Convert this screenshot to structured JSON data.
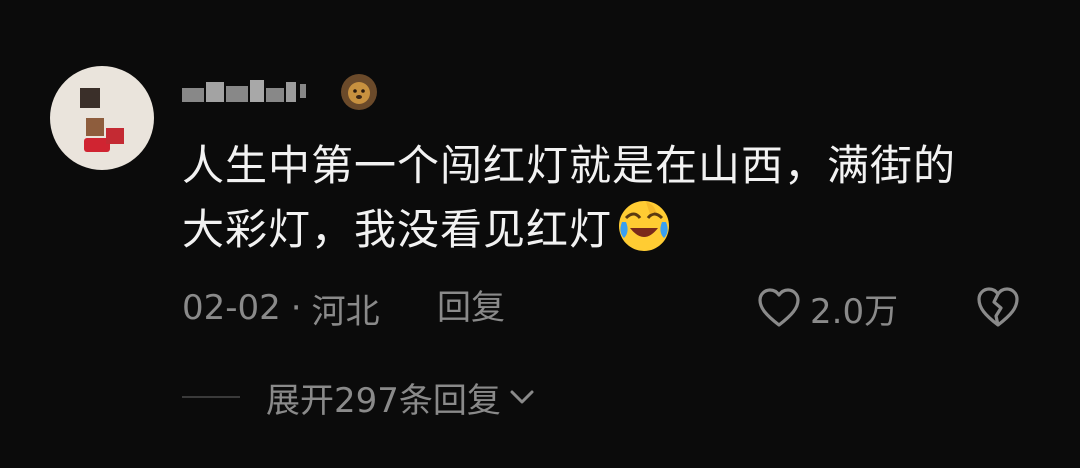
{
  "comment": {
    "text_line1": "人生中第一个闯红灯就是在山西，满街的",
    "text_line2": "大彩灯，我没看见红灯",
    "date": "02-02",
    "separator": "·",
    "location": "河北",
    "reply_label": "回复",
    "like_count": "2.0万",
    "emoji_icon": "laughing-crying-emoji-icon",
    "badge_icon": "lion-badge-icon"
  },
  "replies": {
    "expand_label": "展开297条回复"
  }
}
